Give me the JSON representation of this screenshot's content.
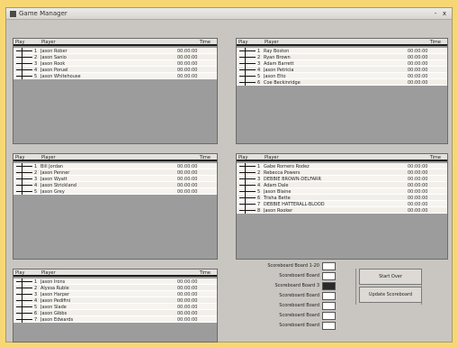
{
  "window": {
    "title": "Game Manager",
    "subtitle": "",
    "min_label": "-",
    "close_label": "x"
  },
  "columns": {
    "play": "Play",
    "player": "Player",
    "time": "Time"
  },
  "panels": [
    {
      "rows": [
        {
          "num": "1",
          "name": "Jason Rober",
          "time": "00:00:00"
        },
        {
          "num": "2",
          "name": "Jason Sanio",
          "time": "00:00:00"
        },
        {
          "num": "3",
          "name": "Jason Rook",
          "time": "00:00:00"
        },
        {
          "num": "4",
          "name": "Jason Poruel",
          "time": "00:00:00"
        },
        {
          "num": "5",
          "name": "Jason Whitehouse",
          "time": "00:00:00"
        }
      ]
    },
    {
      "rows": [
        {
          "num": "1",
          "name": "Ray Boston",
          "time": "00:00:00"
        },
        {
          "num": "2",
          "name": "Ryan Brown",
          "time": "00:00:00"
        },
        {
          "num": "3",
          "name": "Adam Barrett",
          "time": "00:00:00"
        },
        {
          "num": "4",
          "name": "Jason Petricia",
          "time": "00:00:00"
        },
        {
          "num": "5",
          "name": "Jason Elto",
          "time": "00:00:00"
        },
        {
          "num": "6",
          "name": "Coe Beckinridge",
          "time": "00:00:00"
        }
      ]
    },
    {
      "rows": [
        {
          "num": "1",
          "name": "Bill Jordan",
          "time": "00:00:00"
        },
        {
          "num": "2",
          "name": "Jason Penner",
          "time": "00:00:00"
        },
        {
          "num": "3",
          "name": "Jason Wyatt",
          "time": "00:00:00"
        },
        {
          "num": "4",
          "name": "Jason Strickland",
          "time": "00:00:00"
        },
        {
          "num": "5",
          "name": "Jason Grey",
          "time": "00:00:00"
        }
      ]
    },
    {
      "rows": [
        {
          "num": "1",
          "name": "Gabe Romero Rodez",
          "time": "00:00:00"
        },
        {
          "num": "2",
          "name": "Rebecca Powers",
          "time": "00:00:00"
        },
        {
          "num": "3",
          "name": "DEBBIE BROWN-DELFARR",
          "time": "00:00:00"
        },
        {
          "num": "4",
          "name": "Adam Dale",
          "time": "00:00:00"
        },
        {
          "num": "5",
          "name": "Jason Blaine",
          "time": "00:00:00"
        },
        {
          "num": "6",
          "name": "Trisha Bette",
          "time": "00:00:00"
        },
        {
          "num": "7",
          "name": "DEBBIE HATTERALL-BLOOD",
          "time": "00:00:00"
        },
        {
          "num": "8",
          "name": "Jason Rooker",
          "time": "00:00:00"
        }
      ]
    },
    {
      "rows": [
        {
          "num": "1",
          "name": "Jason Irons",
          "time": "00:00:00"
        },
        {
          "num": "2",
          "name": "Alyssa Ruble",
          "time": "00:00:00"
        },
        {
          "num": "3",
          "name": "Jason Harper",
          "time": "00:00:00"
        },
        {
          "num": "4",
          "name": "Jason Pedifini",
          "time": "00:00:00"
        },
        {
          "num": "5",
          "name": "Jason Slade",
          "time": "00:00:00"
        },
        {
          "num": "6",
          "name": "Jason Gibbs",
          "time": "00:00:00"
        },
        {
          "num": "7",
          "name": "Jason Edwards",
          "time": "00:00:00"
        }
      ]
    }
  ],
  "scoreboard": {
    "labels": [
      "Scoreboard Board 1-20",
      "Scoreboard Board",
      "Scoreboard Board 3",
      "Scoreboard Board",
      "Scoreboard Board",
      "Scoreboard Board",
      "Scoreboard Board"
    ]
  },
  "buttons": {
    "start": "Start Over",
    "update": "Update Scoreboard"
  }
}
